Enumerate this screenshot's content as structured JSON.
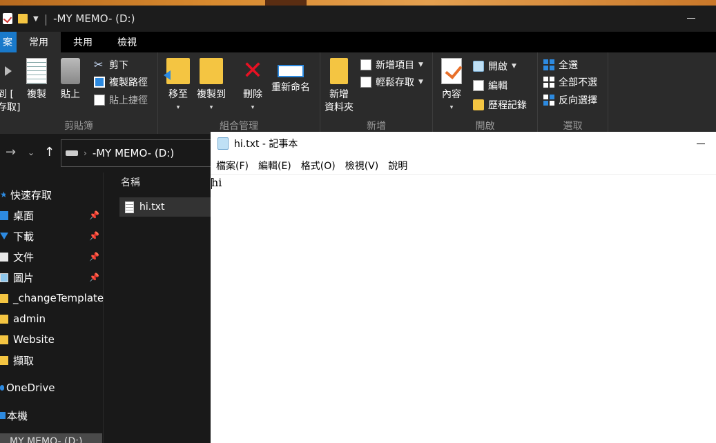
{
  "explorer": {
    "window_title": "-MY MEMO- (D:)",
    "tabs": {
      "file": "案",
      "home": "常用",
      "share": "共用",
      "view": "檢視"
    },
    "ribbon": {
      "clipboard": {
        "label": "剪貼簿",
        "pin": "到 [\n存取]",
        "copy": "複製",
        "paste": "貼上",
        "cut": "剪下",
        "copy_path": "複製路徑",
        "paste_shortcut": "貼上捷徑"
      },
      "organize": {
        "label": "組合管理",
        "move_to": "移至",
        "copy_to": "複製到",
        "delete": "刪除",
        "rename": "重新命名"
      },
      "new": {
        "label": "新增",
        "new_folder": "新增\n資料夾",
        "new_item": "新增項目",
        "easy_access": "輕鬆存取"
      },
      "open": {
        "label": "開啟",
        "properties": "內容",
        "open": "開啟",
        "edit": "編輯",
        "history": "歷程記錄"
      },
      "select": {
        "label": "選取",
        "select_all": "全選",
        "select_none": "全部不選",
        "invert": "反向選擇"
      }
    },
    "address": {
      "path": "-MY MEMO- (D:)"
    },
    "nav": {
      "quick_access": "快速存取",
      "items": [
        {
          "label": "桌面",
          "pinned": true
        },
        {
          "label": "下載",
          "pinned": true
        },
        {
          "label": "文件",
          "pinned": true
        },
        {
          "label": "圖片",
          "pinned": true
        },
        {
          "label": "_changeTemplate",
          "pinned": false
        },
        {
          "label": "admin",
          "pinned": false
        },
        {
          "label": "Website",
          "pinned": false
        },
        {
          "label": "擷取",
          "pinned": false
        }
      ],
      "onedrive": "OneDrive",
      "this_pc": "本機",
      "drive": "MY MEMO- (D:)"
    },
    "file_list": {
      "column_name": "名稱",
      "files": [
        {
          "name": "hi.txt"
        }
      ]
    }
  },
  "notepad": {
    "title": "hi.txt - 記事本",
    "menu": [
      "檔案(F)",
      "編輯(E)",
      "格式(O)",
      "檢視(V)",
      "說明"
    ],
    "content": "hi"
  }
}
